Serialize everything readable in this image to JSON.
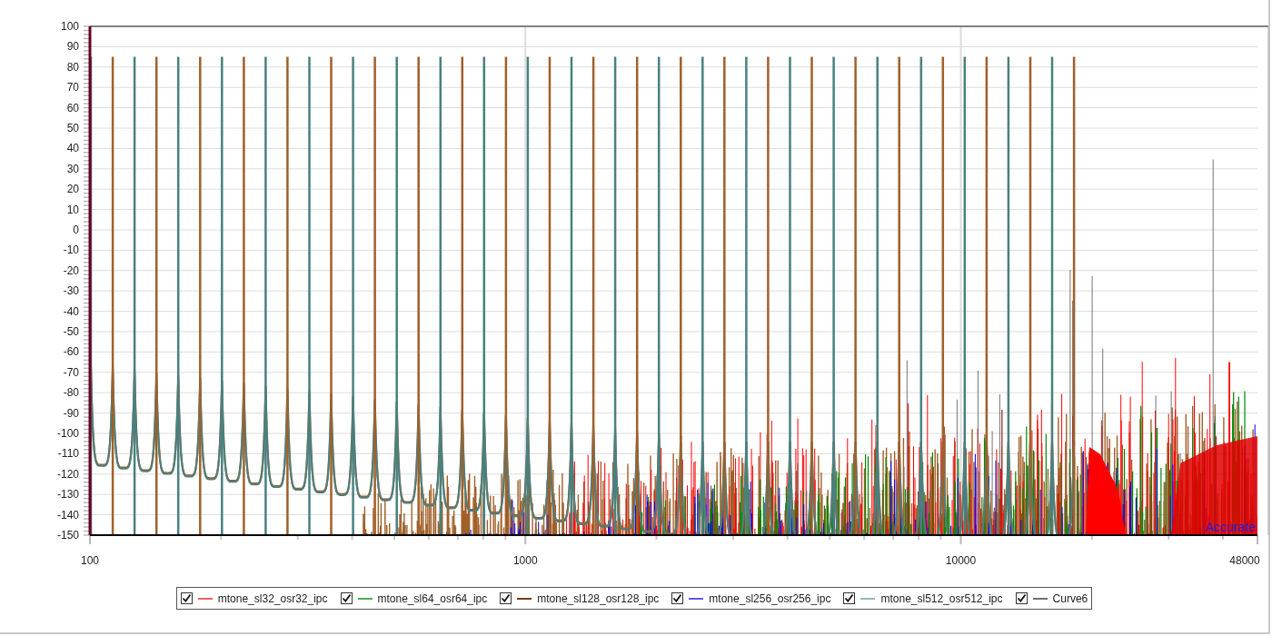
{
  "chart": {
    "y_ticks": [
      "100",
      "90",
      "80",
      "70",
      "60",
      "50",
      "40",
      "30",
      "20",
      "10",
      "0",
      "-10",
      "-20",
      "-30",
      "-40",
      "-50",
      "-60",
      "-70",
      "-80",
      "-90",
      "-100",
      "-110",
      "-120",
      "-130",
      "-140",
      "-150"
    ],
    "x_ticks": [
      "100",
      "1000",
      "10000",
      "48000"
    ],
    "annotation": "Accurate"
  },
  "legend": [
    {
      "label": "mtone_sl32_osr32_ipc",
      "checked": true,
      "color": "#f06464"
    },
    {
      "label": "mtone_sl64_osr64_ipc",
      "checked": true,
      "color": "#4caf50"
    },
    {
      "label": "mtone_sl128_osr128_ipc",
      "checked": true,
      "color": "#7a3a08"
    },
    {
      "label": "mtone_sl256_osr256_ipc",
      "checked": true,
      "color": "#5a5aff"
    },
    {
      "label": "mtone_sl512_osr512_ipc",
      "checked": true,
      "color": "#8cbcb4"
    },
    {
      "label": "Curve6",
      "checked": true,
      "color": "#707070"
    }
  ]
}
